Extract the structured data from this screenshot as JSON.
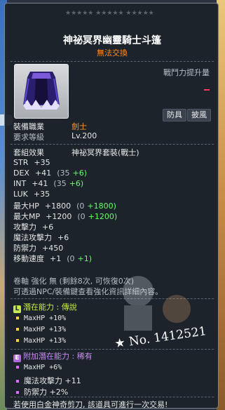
{
  "header": {
    "stars": "★★★★★ ★★★★★ ★★★★★",
    "title": "神祕冥界幽靈騎士斗篷",
    "subtitle": "無法交換",
    "power_label": "戰鬥力提升量"
  },
  "tags": [
    "防具",
    "披風"
  ],
  "requirements": {
    "job_label": "裝備職業",
    "job_value": "劍士",
    "level_label": "要求等級",
    "level_value": "Lv.200"
  },
  "set": {
    "label": "套組效果",
    "value": "神祕冥界套裝(戰士)"
  },
  "stats": [
    {
      "label": "STR",
      "value": "+35",
      "base": "",
      "bonus": ""
    },
    {
      "label": "DEX",
      "value": "+41",
      "base": "(35",
      "bonus": "+6)"
    },
    {
      "label": "INT",
      "value": "+41",
      "base": "(35",
      "bonus": "+6)"
    },
    {
      "label": "LUK",
      "value": "+35",
      "base": "",
      "bonus": ""
    },
    {
      "label": "最大HP",
      "value": "+1800",
      "base": "(0",
      "bonus": "+1800)"
    },
    {
      "label": "最大MP",
      "value": "+1200",
      "base": "(0",
      "bonus": "+1200)"
    },
    {
      "label": "攻擊力",
      "value": "+6",
      "base": "",
      "bonus": ""
    },
    {
      "label": "魔法攻擊力",
      "value": "+6",
      "base": "",
      "bonus": ""
    },
    {
      "label": "防禦力",
      "value": "+450",
      "base": "",
      "bonus": ""
    },
    {
      "label": "移動速度",
      "value": "+1",
      "base": "(0",
      "bonus": "+1)"
    }
  ],
  "scroll_line": "卷軸 強化 無 (剩餘8次, 可恢復0次)",
  "enhance_note": "可透過NPC/裝備鍵查看強化資訊詳細內容。",
  "potential": {
    "badge": "L",
    "title": "潛在能力 : 傳說",
    "lines": [
      "MaxHP +10%",
      "MaxHP +13%",
      "MaxHP +13%"
    ]
  },
  "additional_potential": {
    "badge": "E",
    "title": "附加潛在能力 : 稀有",
    "lines": [
      "MaxHP +6%",
      "魔法攻擊力 +11",
      "防禦力 +2%"
    ]
  },
  "handwritten_note": "★ No. 1412521",
  "footer": "若使用白金神奇剪刀, 該道具可進行一次交易!",
  "colors": {
    "accent_orange": "#ff9a2a",
    "bonus_green": "#66ff66",
    "legend_badge": "#c7e84a",
    "epic_badge": "#b06ad9"
  }
}
